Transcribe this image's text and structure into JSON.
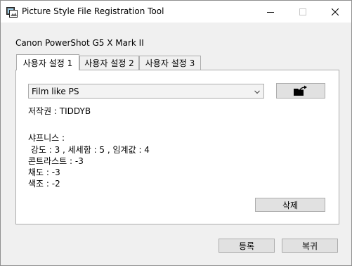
{
  "window": {
    "title": "Picture Style File Registration Tool",
    "controls": {
      "minimize": "minimize",
      "maximize": "maximize",
      "close": "close"
    }
  },
  "camera_model": "Canon PowerShot G5 X Mark II",
  "tabs": [
    {
      "label": "사용자 설정 1",
      "active": true
    },
    {
      "label": "사용자 설정 2",
      "active": false
    },
    {
      "label": "사용자 설정 3",
      "active": false
    }
  ],
  "panel": {
    "selected_style": "Film like PS",
    "copyright": "저작권 : TIDDYB",
    "sharpness_heading": "샤프니스 :",
    "sharpness_values": " 강도 : 3 , 세세함 : 5 , 임계값 : 4",
    "contrast": "콘트라스트 : -3",
    "saturation": "채도 : -3",
    "color_tone": "색조 : -2",
    "delete_label": "삭제"
  },
  "footer": {
    "register_label": "등록",
    "cancel_label": "복귀"
  },
  "icons": {
    "app": "picture-style-app-icon",
    "export": "folder-export-icon",
    "dropdown": "chevron-down-icon"
  }
}
